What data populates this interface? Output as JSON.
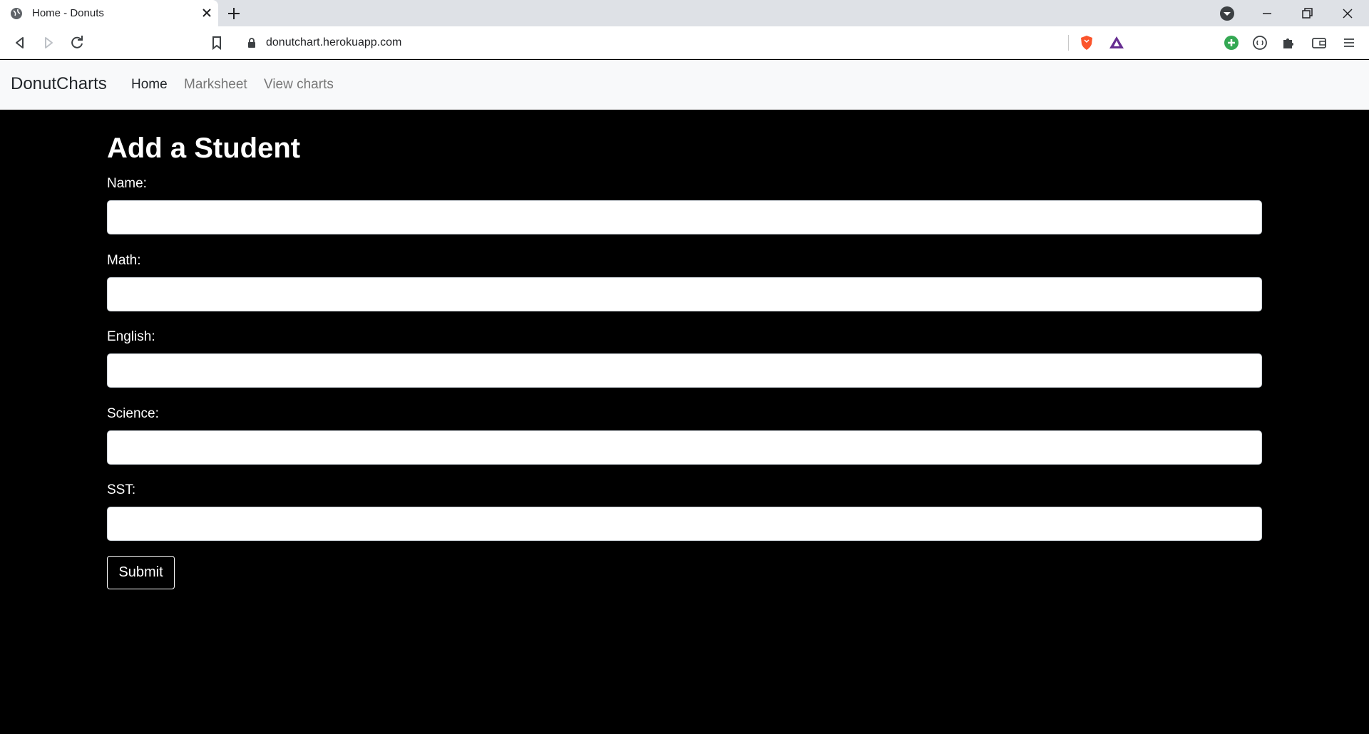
{
  "browser": {
    "tab_title": "Home - Donuts",
    "url": "donutchart.herokuapp.com"
  },
  "navbar": {
    "brand": "DonutCharts",
    "links": [
      {
        "label": "Home",
        "active": true
      },
      {
        "label": "Marksheet",
        "active": false
      },
      {
        "label": "View charts",
        "active": false
      }
    ]
  },
  "form": {
    "title": "Add a Student",
    "fields": [
      {
        "label": "Name:",
        "value": ""
      },
      {
        "label": "Math:",
        "value": ""
      },
      {
        "label": "English:",
        "value": ""
      },
      {
        "label": "Science:",
        "value": ""
      },
      {
        "label": "SST:",
        "value": ""
      }
    ],
    "submit_label": "Submit"
  },
  "colors": {
    "page_background": "#000000",
    "navbar_background": "#f8f9fa",
    "brave_orange": "#fb542b",
    "bat_purple": "#662d91",
    "green_extension": "#34a853"
  }
}
